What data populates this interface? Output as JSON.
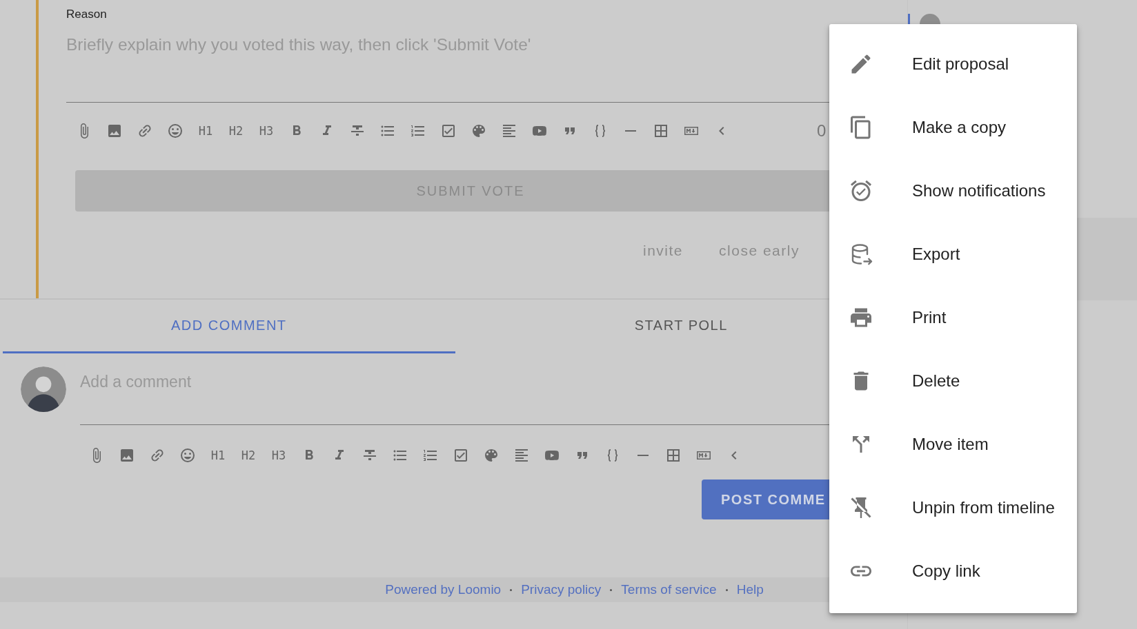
{
  "vote_form": {
    "reason_label": "Reason",
    "reason_placeholder": "Briefly explain why you voted this way, then click 'Submit Vote'",
    "toolbar_headings": [
      "H1",
      "H2",
      "H3"
    ],
    "char_count": "0",
    "submit_button": "SUBMIT VOTE",
    "actions": [
      "invite",
      "close early"
    ]
  },
  "tabs": [
    {
      "label": "ADD COMMENT",
      "selected": true
    },
    {
      "label": "START POLL",
      "selected": false
    }
  ],
  "comment_form": {
    "placeholder": "Add a comment",
    "toolbar_headings": [
      "H1",
      "H2",
      "H3"
    ],
    "post_button": "POST COMME"
  },
  "footer_links": [
    "Powered by Loomio",
    "Privacy policy",
    "Terms of service",
    "Help"
  ],
  "menu": [
    {
      "label": "Edit proposal"
    },
    {
      "label": "Make a copy"
    },
    {
      "label": "Show notifications"
    },
    {
      "label": "Export"
    },
    {
      "label": "Print"
    },
    {
      "label": "Delete"
    },
    {
      "label": "Move item"
    },
    {
      "label": "Unpin from timeline"
    },
    {
      "label": "Copy link"
    }
  ]
}
